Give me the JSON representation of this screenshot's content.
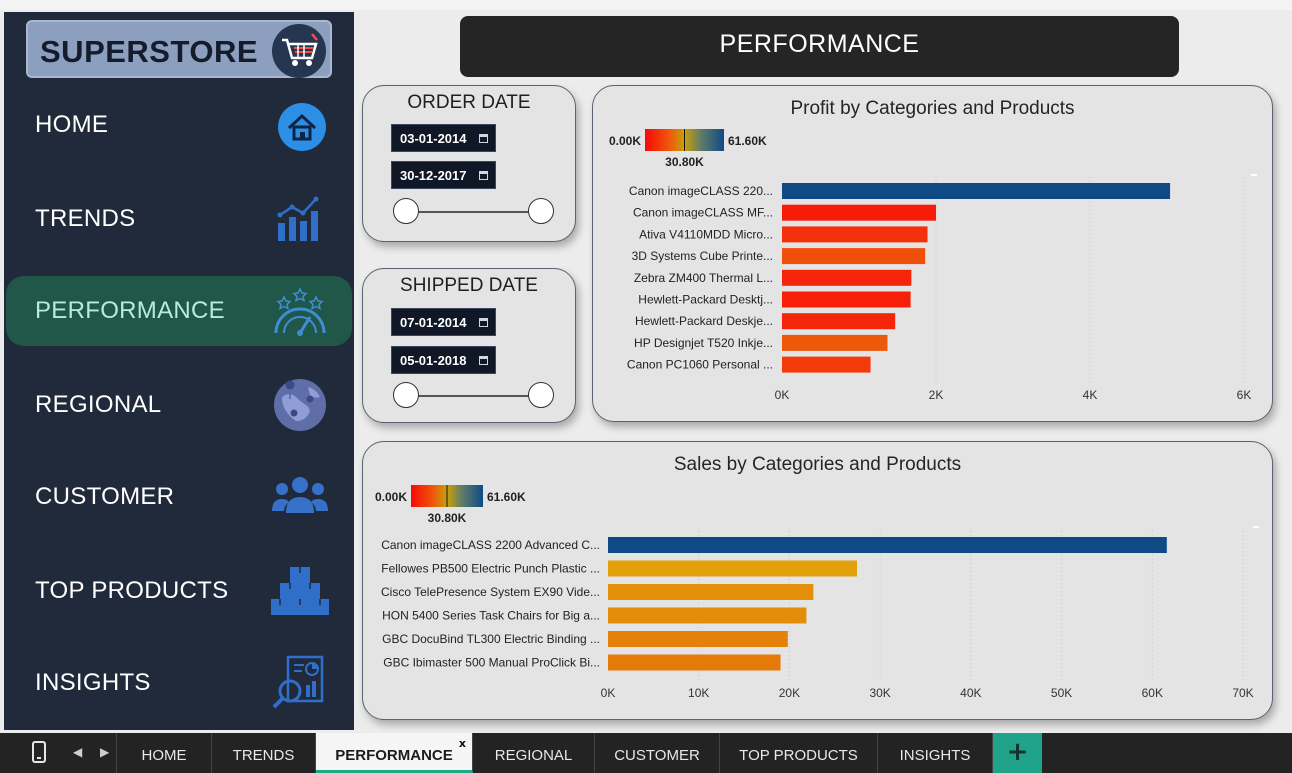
{
  "brand": {
    "title": "SUPERSTORE"
  },
  "nav": [
    {
      "label": "HOME",
      "icon": "home-icon",
      "active": false
    },
    {
      "label": "TRENDS",
      "icon": "trends-chart-icon",
      "active": false
    },
    {
      "label": "PERFORMANCE",
      "icon": "performance-gauge-icon",
      "active": true
    },
    {
      "label": "REGIONAL",
      "icon": "globe-map-icon",
      "active": false
    },
    {
      "label": "CUSTOMER",
      "icon": "users-group-icon",
      "active": false
    },
    {
      "label": "TOP PRODUCTS",
      "icon": "boxes-icon",
      "active": false
    },
    {
      "label": "INSIGHTS",
      "icon": "report-magnifier-icon",
      "active": false
    }
  ],
  "page_title": "PERFORMANCE",
  "order_date": {
    "title": "ORDER DATE",
    "start": "03-01-2014",
    "end": "30-12-2017"
  },
  "shipped_date": {
    "title": "SHIPPED DATE",
    "start": "07-01-2014",
    "end": "05-01-2018"
  },
  "colors": {
    "sidebar": "#212a3a",
    "active_nav": "#215748",
    "accent": "#1fa38a",
    "bar_high": "#0f4a86",
    "bar_low": "#f41a0a"
  },
  "chart_data": [
    {
      "type": "bar",
      "orientation": "horizontal",
      "title": "Profit by Categories and Products",
      "legend": {
        "min_label": "0.00K",
        "mid_label": "30.80K",
        "max_label": "61.60K",
        "min": 0,
        "mid": 30800,
        "max": 61600
      },
      "categories": [
        "Canon imageCLASS 220...",
        "Canon imageCLASS MF...",
        "Ativa V4110MDD Micro...",
        "3D Systems Cube Printe...",
        "Zebra ZM400 Thermal L...",
        "Hewlett-Packard Desktj...",
        "Hewlett-Packard Deskje...",
        "HP Designjet T520 Inkje...",
        "Canon PC1060 Personal ..."
      ],
      "values": [
        5040,
        2000,
        1890,
        1860,
        1680,
        1670,
        1470,
        1370,
        1150
      ],
      "bar_colors": [
        "#0f4a86",
        "#f71c0a",
        "#f4300a",
        "#ef4f0a",
        "#f4250a",
        "#f71e0a",
        "#f4260a",
        "#ec590a",
        "#f43a0a"
      ],
      "xlim": [
        0,
        6000
      ],
      "xticks": [
        0,
        2000,
        4000,
        6000
      ],
      "xtick_labels": [
        "0K",
        "2K",
        "4K",
        "6K"
      ]
    },
    {
      "type": "bar",
      "orientation": "horizontal",
      "title": "Sales by Categories and Products",
      "legend": {
        "min_label": "0.00K",
        "mid_label": "30.80K",
        "max_label": "61.60K",
        "min": 0,
        "mid": 30800,
        "max": 61600
      },
      "categories": [
        "Canon imageCLASS 2200 Advanced C...",
        "Fellowes PB500 Electric Punch Plastic ...",
        "Cisco TelePresence System EX90 Vide...",
        "HON 5400 Series Task Chairs for Big a...",
        "GBC DocuBind TL300 Electric Binding ...",
        "GBC Ibimaster 500 Manual ProClick Bi..."
      ],
      "values": [
        61600,
        27450,
        22640,
        21870,
        19820,
        19020
      ],
      "bar_colors": [
        "#0f4a86",
        "#e2a00a",
        "#e48f0a",
        "#e48d0a",
        "#e5800a",
        "#e5790a"
      ],
      "xlim": [
        0,
        70000
      ],
      "xticks": [
        0,
        10000,
        20000,
        30000,
        40000,
        50000,
        60000,
        70000
      ],
      "xtick_labels": [
        "0K",
        "10K",
        "20K",
        "30K",
        "40K",
        "50K",
        "60K",
        "70K"
      ]
    }
  ],
  "tabs": [
    {
      "label": "HOME",
      "active": false
    },
    {
      "label": "TRENDS",
      "active": false
    },
    {
      "label": "PERFORMANCE",
      "active": true
    },
    {
      "label": "REGIONAL",
      "active": false
    },
    {
      "label": "CUSTOMER",
      "active": false
    },
    {
      "label": "TOP PRODUCTS",
      "active": false
    },
    {
      "label": "INSIGHTS",
      "active": false
    }
  ],
  "tab_close": "x",
  "add_tab": "+",
  "nav_prev": "◀",
  "nav_next": "▶"
}
